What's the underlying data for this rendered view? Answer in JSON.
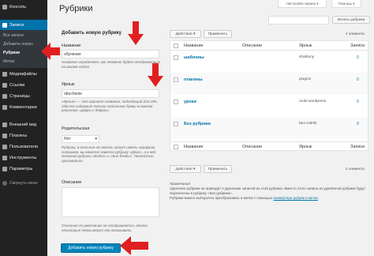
{
  "screen_options": {
    "screen_options_label": "Настройки экрана",
    "help_label": "Помощь"
  },
  "sidebar": {
    "items": [
      {
        "label": "Консоль",
        "icon": "dashboard-icon"
      },
      {
        "label": "Записи",
        "icon": "pin-icon"
      },
      {
        "label": "Медиафайлы",
        "icon": "media-icon"
      },
      {
        "label": "Ссылки",
        "icon": "link-icon"
      },
      {
        "label": "Страницы",
        "icon": "page-icon"
      },
      {
        "label": "Комментарии",
        "icon": "comment-icon"
      },
      {
        "label": "Внешний вид",
        "icon": "brush-icon"
      },
      {
        "label": "Плагины",
        "icon": "plugin-icon"
      },
      {
        "label": "Пользователи",
        "icon": "users-icon"
      },
      {
        "label": "Инструменты",
        "icon": "tools-icon"
      },
      {
        "label": "Параметры",
        "icon": "settings-icon"
      }
    ],
    "submenu": [
      "Все записи",
      "Добавить новую",
      "Рубрики",
      "Метки"
    ],
    "collapse_label": "Свернуть меню"
  },
  "page": {
    "title": "Рубрики",
    "search_button": "Искать рубрики"
  },
  "form": {
    "heading": "Добавить новую рубрику",
    "name_label": "Название",
    "name_value": "обучение",
    "name_desc": "Название определяет, как элемент будет отображаться на вашем сайте.",
    "slug_label": "Ярлык",
    "slug_value": "obuchenie",
    "slug_desc": "«Ярлык» — это вариант названия, подходящий для URL. Обычно содержит только латинские буквы в нижнем регистре, цифры и дефисы.",
    "parent_label": "Родительская",
    "parent_value": "Нет",
    "parent_desc": "Рубрики, в отличие от меток, могут иметь иерархию. Например, вы можете завести рубрику «Джаз», а в ней дочерние рубрики «Бибоп» и «Биг-бэнды». Полностью произвольно.",
    "description_label": "Описание",
    "description_desc": "Описание по умолчанию не отображается, однако некоторые темы могут его показывать.",
    "submit_label": "Добавить новую рубрику"
  },
  "table": {
    "bulk_label": "Действия",
    "apply_label": "Применить",
    "items_count": "4 элемента",
    "columns": {
      "name": "Название",
      "description": "Описание",
      "slug": "Ярлык",
      "count": "Записи"
    },
    "rows": [
      {
        "name": "шаблоны",
        "slug": "shablony",
        "count": "0"
      },
      {
        "name": "плагины",
        "slug": "plugins",
        "count": "0"
      },
      {
        "name": "уроки",
        "slug": "uroki-wordpress",
        "count": "0"
      },
      {
        "name": "Без рубрики",
        "slug": "bez-rubriki",
        "count": "0"
      }
    ]
  },
  "notes": {
    "heading": "Примечание:",
    "line1": "Удаление рубрики не приводит к удалению записей из этой рубрики. Вместо этого записи из удалённой рубрики будут перенесены в рубрику «Без рубрики».",
    "line2_prefix": "Рубрики можно выборочно преобразовать в метки с помощью ",
    "link_label": "конвертера рубрик в метки",
    "line2_suffix": "."
  },
  "colors": {
    "sidebar_bg": "#222222",
    "accent": "#0073aa",
    "primary_button": "#0085ba",
    "arrow": "#e02020"
  }
}
